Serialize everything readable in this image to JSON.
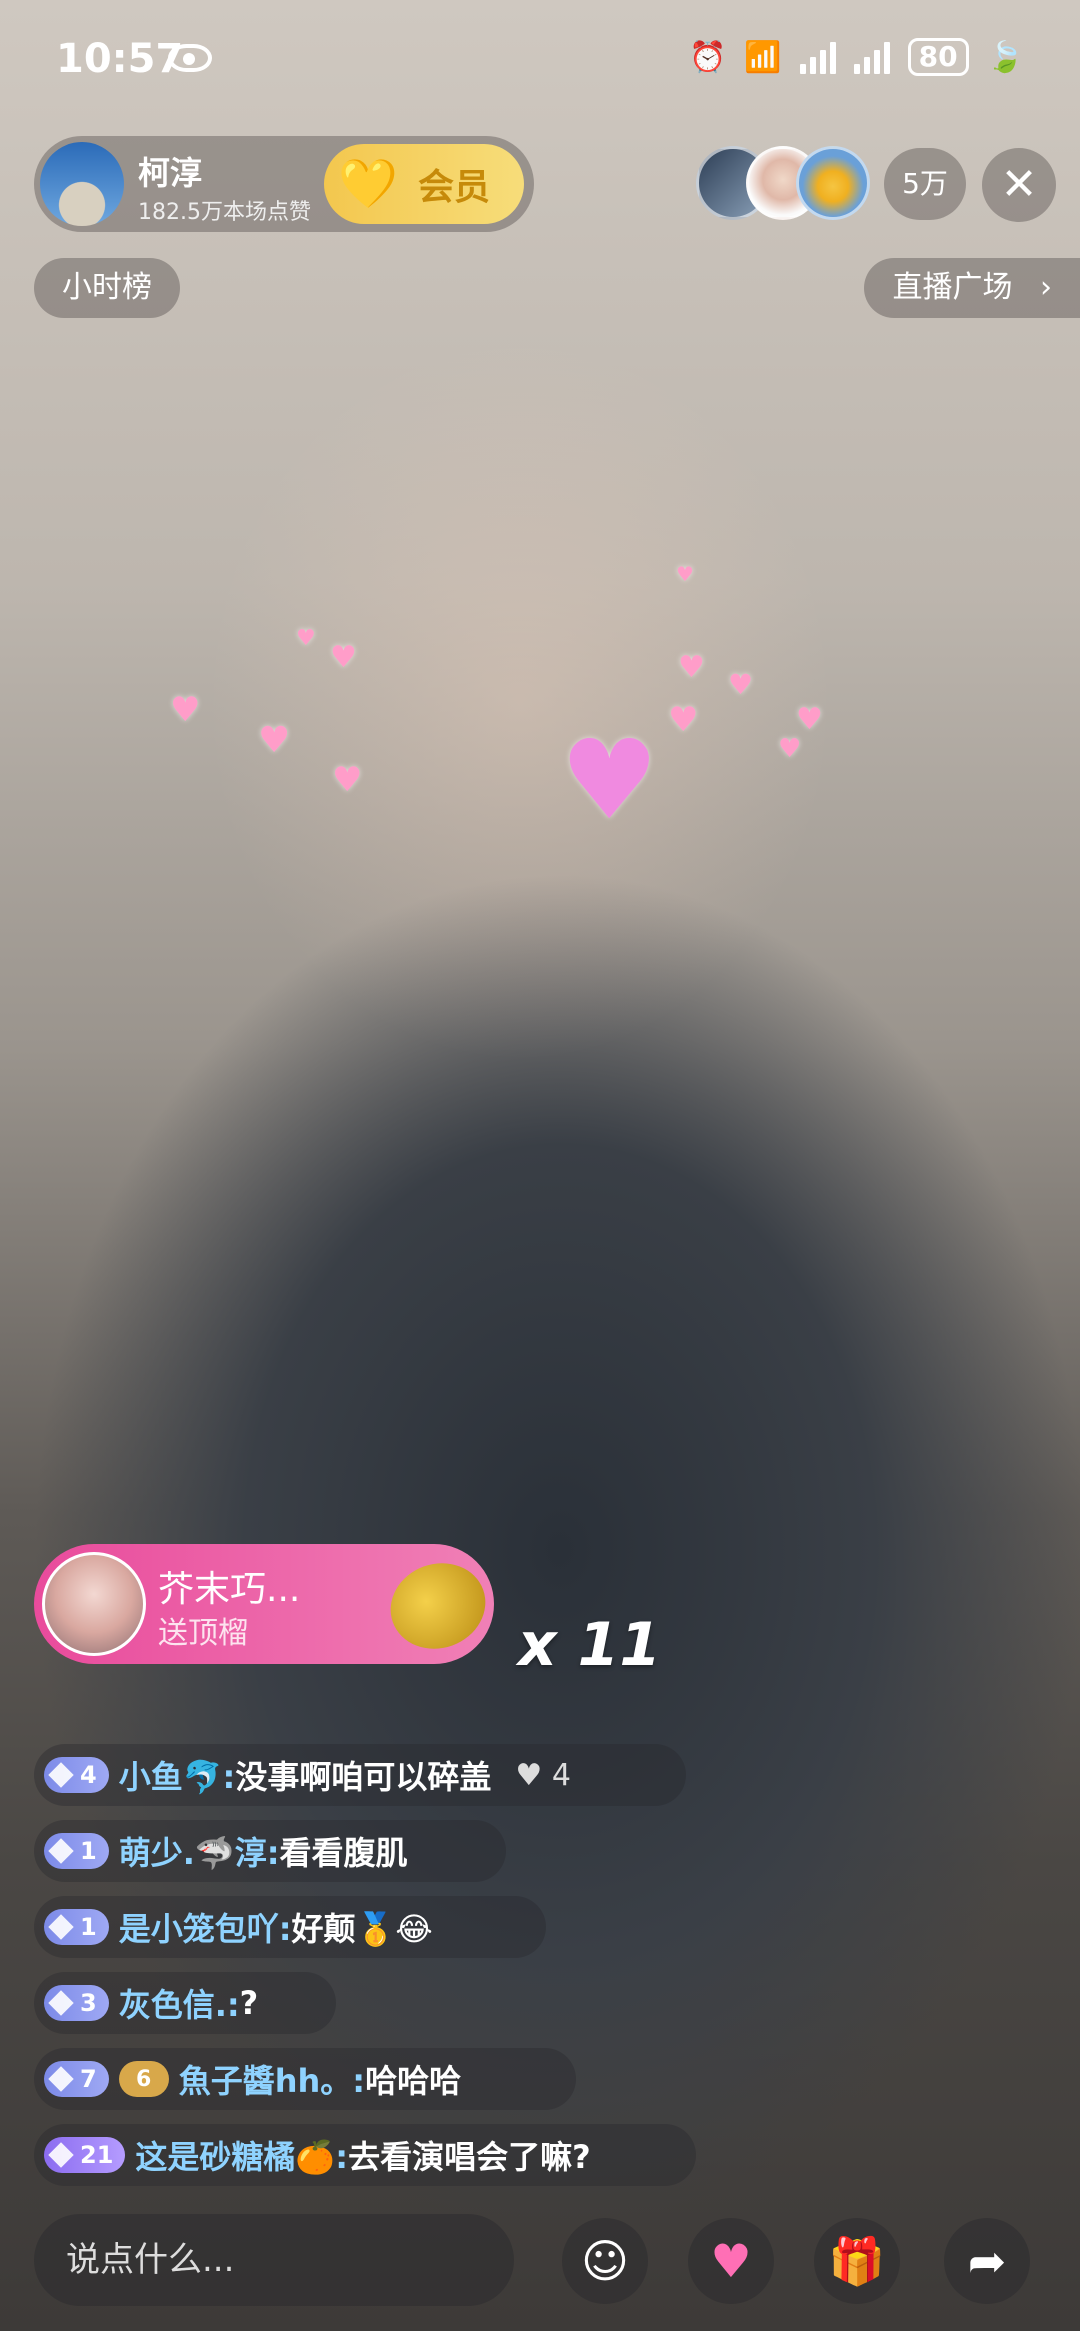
{
  "status_bar": {
    "time": "10:57",
    "battery": "80",
    "icons": [
      "eye-icon",
      "alarm-icon",
      "wifi-icon",
      "signal-icon",
      "signal-icon",
      "leaf-icon"
    ]
  },
  "anchor": {
    "name": "柯淳",
    "likes": "182.5万本场点赞",
    "vip_label": "会员"
  },
  "viewers": {
    "count": "5万"
  },
  "nav": {
    "hourly_rank": "小时榜",
    "live_plaza": "直播广场"
  },
  "gift": {
    "sender": "芥末巧...",
    "desc": "送顶榴",
    "combo": "x 11"
  },
  "comments": [
    {
      "level": "4",
      "user": "小鱼🐬:",
      "text": "没事啊咱可以碎盖",
      "likes": "4"
    },
    {
      "level": "1",
      "user": "萌少.🦈淳:",
      "text": "看看腹肌"
    },
    {
      "level": "1",
      "user": "是小笼包吖:",
      "text": "好颠🥇😂"
    },
    {
      "level": "3",
      "user": "灰色信.:",
      "text": "?"
    },
    {
      "level": "7",
      "fan": "6",
      "user": "魚子醬hh。:",
      "text": "哈哈哈"
    },
    {
      "level": "21",
      "user": "这是砂糖橘🍊:",
      "text": "去看演唱会了嘛?"
    }
  ],
  "input": {
    "placeholder": "说点什么..."
  },
  "colors": {
    "vip_gold": "#f3c74e",
    "gift_pink": "#e94b9c",
    "username_blue": "#8fd3ff"
  }
}
